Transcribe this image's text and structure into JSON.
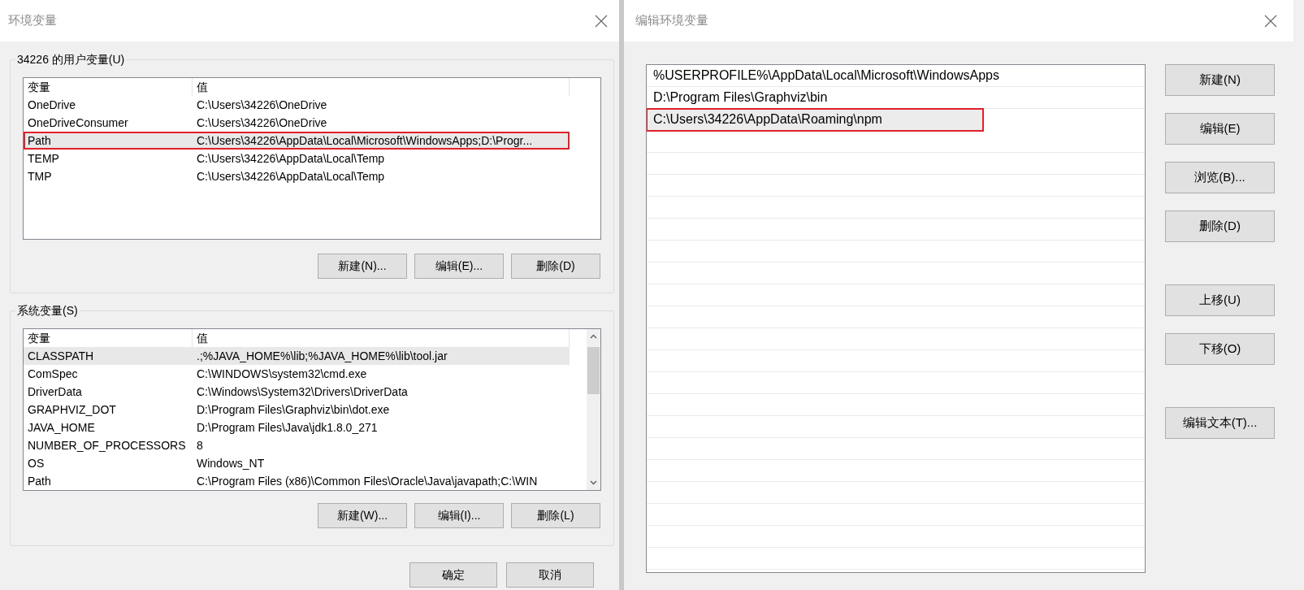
{
  "env_window": {
    "title": "环境变量",
    "user_group": {
      "label": "34226 的用户变量(U)",
      "columns": [
        "变量",
        "值"
      ],
      "rows": [
        {
          "name": "OneDrive",
          "value": "C:\\Users\\34226\\OneDrive",
          "selected": false,
          "highlighted": false
        },
        {
          "name": "OneDriveConsumer",
          "value": "C:\\Users\\34226\\OneDrive",
          "selected": false,
          "highlighted": false
        },
        {
          "name": "Path",
          "value": "C:\\Users\\34226\\AppData\\Local\\Microsoft\\WindowsApps;D:\\Progr...",
          "selected": true,
          "highlighted": true
        },
        {
          "name": "TEMP",
          "value": "C:\\Users\\34226\\AppData\\Local\\Temp",
          "selected": false,
          "highlighted": false
        },
        {
          "name": "TMP",
          "value": "C:\\Users\\34226\\AppData\\Local\\Temp",
          "selected": false,
          "highlighted": false
        }
      ],
      "buttons": [
        "新建(N)...",
        "编辑(E)...",
        "删除(D)"
      ]
    },
    "system_group": {
      "label": "系统变量(S)",
      "columns": [
        "变量",
        "值"
      ],
      "rows": [
        {
          "name": "CLASSPATH",
          "value": ".;%JAVA_HOME%\\lib;%JAVA_HOME%\\lib\\tool.jar",
          "selected": true,
          "highlighted": false
        },
        {
          "name": "ComSpec",
          "value": "C:\\WINDOWS\\system32\\cmd.exe",
          "selected": false,
          "highlighted": false
        },
        {
          "name": "DriverData",
          "value": "C:\\Windows\\System32\\Drivers\\DriverData",
          "selected": false,
          "highlighted": false
        },
        {
          "name": "GRAPHVIZ_DOT",
          "value": "D:\\Program Files\\Graphviz\\bin\\dot.exe",
          "selected": false,
          "highlighted": false
        },
        {
          "name": "JAVA_HOME",
          "value": "D:\\Program Files\\Java\\jdk1.8.0_271",
          "selected": false,
          "highlighted": false
        },
        {
          "name": "NUMBER_OF_PROCESSORS",
          "value": "8",
          "selected": false,
          "highlighted": false
        },
        {
          "name": "OS",
          "value": "Windows_NT",
          "selected": false,
          "highlighted": false
        },
        {
          "name": "Path",
          "value": "C:\\Program Files (x86)\\Common Files\\Oracle\\Java\\javapath;C:\\WIN",
          "selected": false,
          "highlighted": false
        }
      ],
      "buttons": [
        "新建(W)...",
        "编辑(I)...",
        "删除(L)"
      ]
    },
    "buttons": [
      "确定",
      "取消"
    ]
  },
  "edit_window": {
    "title": "编辑环境变量",
    "entries": [
      {
        "text": "%USERPROFILE%\\AppData\\Local\\Microsoft\\WindowsApps",
        "selected": false,
        "highlighted": false
      },
      {
        "text": "D:\\Program Files\\Graphviz\\bin",
        "selected": false,
        "highlighted": false
      },
      {
        "text": "C:\\Users\\34226\\AppData\\Roaming\\npm",
        "selected": true,
        "highlighted": true
      }
    ],
    "button_groups": [
      [
        "新建(N)",
        "编辑(E)",
        "浏览(B)...",
        "删除(D)"
      ],
      [
        "上移(U)",
        "下移(O)"
      ],
      [
        "编辑文本(T)..."
      ]
    ]
  }
}
